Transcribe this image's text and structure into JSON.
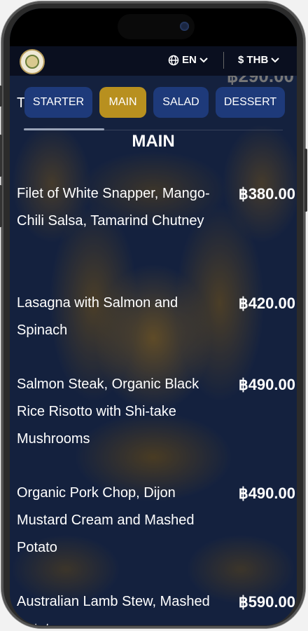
{
  "header": {
    "language": "EN",
    "currency": "$ THB"
  },
  "peek": {
    "letter": "T",
    "price": "฿290.00"
  },
  "tabs": [
    {
      "label": "STARTER"
    },
    {
      "label": "MAIN"
    },
    {
      "label": "SALAD"
    },
    {
      "label": "DESSERT"
    }
  ],
  "section_title": "MAIN",
  "items": [
    {
      "name": "Filet of White Snapper, Mango-Chili Salsa, Tamarind Chutney",
      "price": "฿380.00"
    },
    {
      "name": "Lasagna with Salmon and Spinach",
      "price": "฿420.00"
    },
    {
      "name": "Salmon Steak, Organic Black Rice Risotto with Shi-take Mushrooms",
      "price": "฿490.00"
    },
    {
      "name": "Organic Pork Chop, Dijon Mustard Cream and Mashed Potato",
      "price": "฿490.00"
    },
    {
      "name": "Australian Lamb Stew, Mashed Potato",
      "price": "฿590.00"
    }
  ],
  "colors": {
    "active_tab": "#b8901f",
    "tab": "#1e3a7a"
  },
  "icons": [
    "globe-icon",
    "chevron-down-icon"
  ]
}
